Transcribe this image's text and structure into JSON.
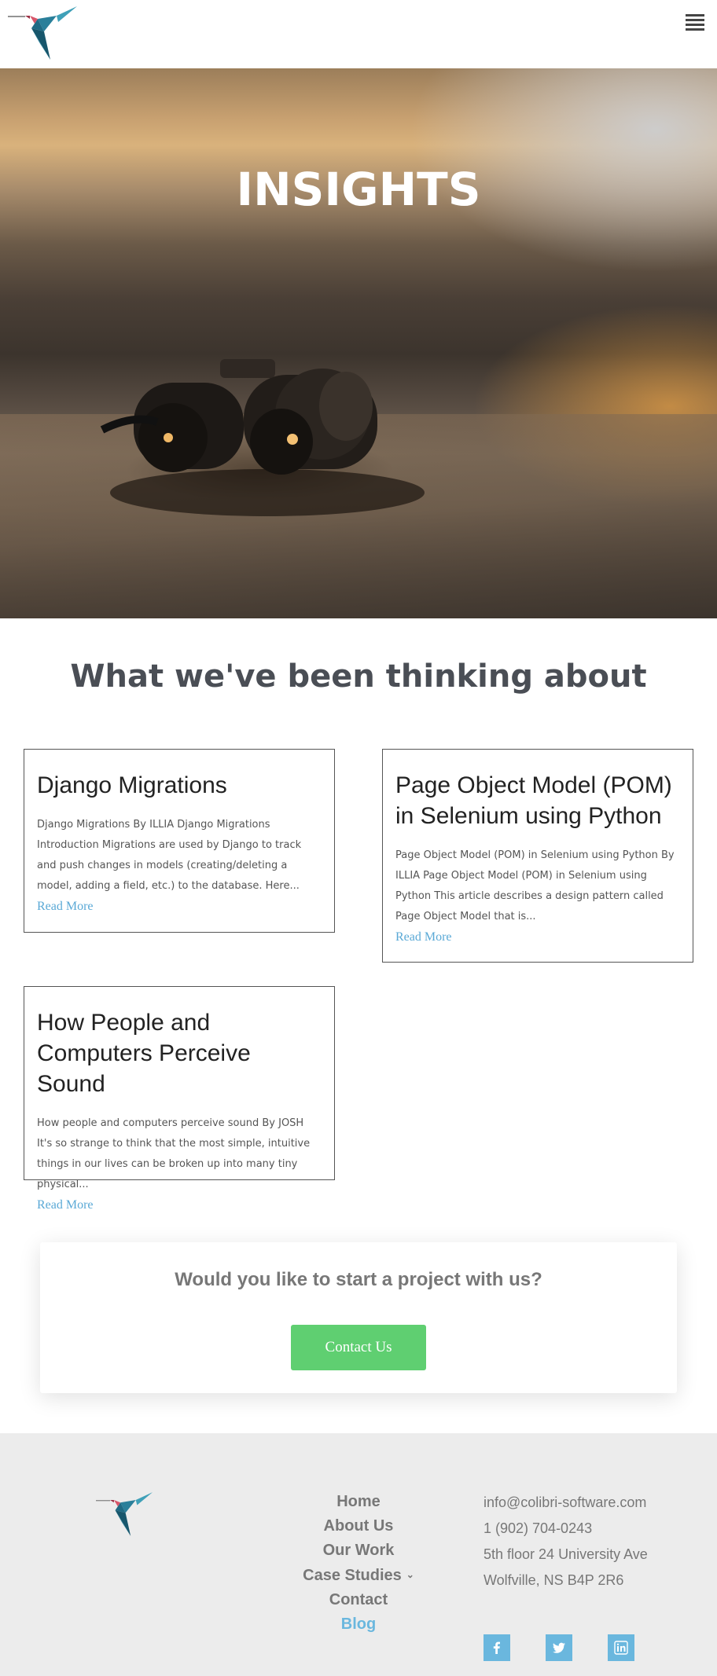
{
  "header": {
    "logo_icon": "hummingbird-logo-icon",
    "menu_icon": "hamburger-menu-icon"
  },
  "hero": {
    "title": "INSIGHTS"
  },
  "section": {
    "title": "What we've been thinking about"
  },
  "posts": [
    {
      "title": "Django Migrations",
      "excerpt": "Django Migrations By ILLIA Django Migrations Introduction Migrations are used by Django to track and push changes in models (creating/deleting a model, adding a field, etc.) to the database. Here...",
      "link": "Read More"
    },
    {
      "title": "Page Object Model (POM) in Selenium using Python",
      "excerpt": "Page Object Model (POM) in Selenium using Python By ILLIA Page Object Model (POM) in Selenium using Python This article describes a design pattern called Page Object Model that is...",
      "link": "Read More"
    },
    {
      "title": "How People and Computers Perceive Sound",
      "excerpt": "How people and computers perceive sound By JOSH It's so strange to think that the most simple, intuitive things in our lives can be broken up into many tiny physical...",
      "link": "Read More"
    }
  ],
  "cta": {
    "title": "Would you like to start a project with us?",
    "button": "Contact Us"
  },
  "footer": {
    "nav": [
      "Home",
      "About Us",
      "Our Work",
      "Case Studies",
      "Contact",
      "Blog"
    ],
    "active": "Blog",
    "contact": {
      "email": "info@colibri-software.com",
      "phone": "1 (902) 704-0243",
      "address_line1": "5th floor 24 University Ave",
      "address_line2": "Wolfville, NS B4P 2R6"
    },
    "social": [
      "facebook-icon",
      "twitter-icon",
      "linkedin-icon"
    ]
  },
  "colors": {
    "accent": "#6ab7de",
    "cta_button": "#5fcf71",
    "footer_bg": "#ececec",
    "heading": "#4a4e55"
  }
}
